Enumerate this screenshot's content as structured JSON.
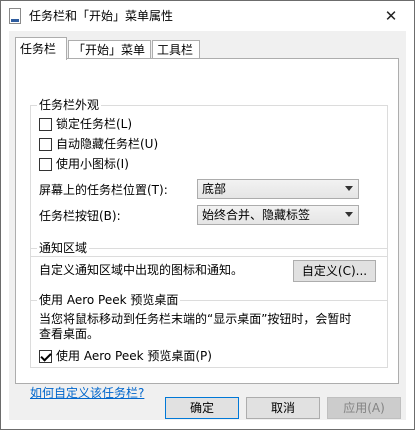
{
  "window": {
    "title": "任务栏和「开始」菜单属性",
    "close_glyph": "✕"
  },
  "tabs": [
    {
      "label": "任务栏",
      "active": true
    },
    {
      "label": "「开始」菜单",
      "active": false
    },
    {
      "label": "工具栏",
      "active": false
    }
  ],
  "appearance": {
    "legend": "任务栏外观",
    "lock_taskbar": {
      "label": "锁定任务栏(L)",
      "checked": false
    },
    "auto_hide": {
      "label": "自动隐藏任务栏(U)",
      "checked": false
    },
    "small_icons": {
      "label": "使用小图标(I)",
      "checked": false
    },
    "location_label": "屏幕上的任务栏位置(T):",
    "location_value": "底部",
    "buttons_label": "任务栏按钮(B):",
    "buttons_value": "始终合并、隐藏标签"
  },
  "notification": {
    "legend": "通知区域",
    "description": "自定义通知区域中出现的图标和通知。",
    "customize_button": "自定义(C)..."
  },
  "peek": {
    "legend": "使用 Aero Peek 预览桌面",
    "description": "当您将鼠标移动到任务栏末端的“显示桌面”按钮时，会暂时\n查看桌面。",
    "use_peek": {
      "label": "使用 Aero Peek 预览桌面(P)",
      "checked": true
    }
  },
  "help_link": "如何自定义该任务栏?",
  "footer": {
    "ok": "确定",
    "cancel": "取消",
    "apply": "应用(A)"
  },
  "colors": {
    "accent": "#0078d7",
    "link": "#0066cc",
    "client_bg": "#f0f0f0"
  }
}
